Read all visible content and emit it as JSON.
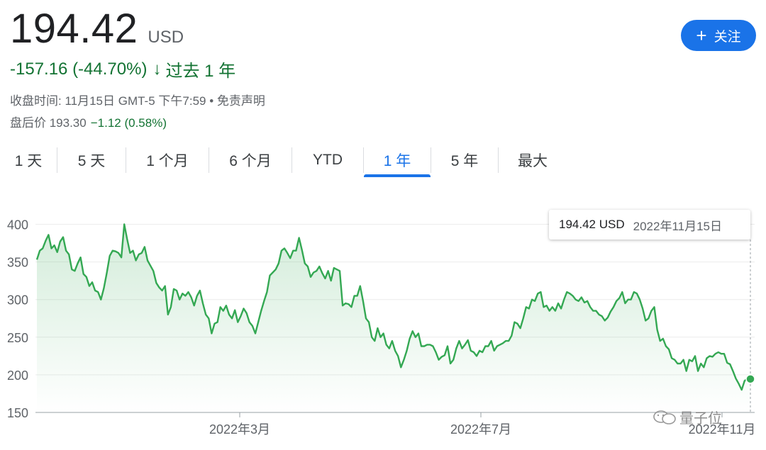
{
  "header": {
    "price": "194.42",
    "currency": "USD",
    "change_text": "-157.16 (-44.70%)",
    "change_arrow": "↓",
    "period_text": "过去 1 年",
    "close_info": "收盘时间: 11月15日 GMT-5 下午7:59 • 免责声明",
    "after_label": "盘后价 193.30",
    "after_change": "−1.12 (0.58%)",
    "follow_label": "关注",
    "follow_icon": "plus-icon"
  },
  "tabs": [
    {
      "label": "1 天",
      "active": false
    },
    {
      "label": "5 天",
      "active": false
    },
    {
      "label": "1 个月",
      "active": false
    },
    {
      "label": "6 个月",
      "active": false
    },
    {
      "label": "YTD",
      "active": false
    },
    {
      "label": "1 年",
      "active": true
    },
    {
      "label": "5 年",
      "active": false
    },
    {
      "label": "最大",
      "active": false
    }
  ],
  "tooltip": {
    "price": "194.42 USD",
    "date": "2022年11月15日"
  },
  "watermark": {
    "text": "量子位",
    "icon": "wechat-icon"
  },
  "colors": {
    "line": "#34a853",
    "accent": "#1a73e8",
    "positive_text": "#137333"
  },
  "chart_data": {
    "type": "area",
    "x_ticks": [
      "2022年3月",
      "2022年7月",
      "2022年11月"
    ],
    "y_ticks": [
      150,
      200,
      250,
      300,
      350,
      400
    ],
    "ylim": [
      150,
      405
    ],
    "grid": true,
    "values": [
      353,
      365,
      368,
      378,
      386,
      368,
      372,
      363,
      377,
      383,
      365,
      360,
      340,
      338,
      348,
      356,
      334,
      330,
      318,
      323,
      312,
      310,
      300,
      315,
      335,
      358,
      365,
      364,
      362,
      356,
      400,
      380,
      362,
      365,
      352,
      360,
      362,
      370,
      352,
      345,
      338,
      322,
      316,
      312,
      318,
      280,
      290,
      314,
      312,
      300,
      308,
      305,
      310,
      303,
      292,
      305,
      312,
      295,
      280,
      275,
      255,
      268,
      270,
      290,
      285,
      292,
      280,
      275,
      286,
      270,
      278,
      288,
      282,
      270,
      265,
      255,
      270,
      285,
      298,
      310,
      332,
      336,
      340,
      348,
      365,
      368,
      362,
      355,
      365,
      365,
      382,
      366,
      348,
      344,
      330,
      336,
      338,
      344,
      335,
      328,
      338,
      325,
      342,
      340,
      338,
      292,
      295,
      294,
      290,
      305,
      305,
      318,
      298,
      275,
      270,
      250,
      245,
      262,
      250,
      255,
      240,
      235,
      245,
      232,
      225,
      210,
      220,
      232,
      248,
      258,
      250,
      255,
      238,
      238,
      240,
      240,
      238,
      230,
      220,
      224,
      226,
      238,
      215,
      220,
      235,
      245,
      235,
      240,
      246,
      232,
      230,
      225,
      232,
      230,
      238,
      238,
      245,
      232,
      238,
      240,
      242,
      245,
      245,
      252,
      270,
      268,
      262,
      275,
      290,
      288,
      300,
      298,
      308,
      310,
      290,
      292,
      285,
      290,
      285,
      295,
      288,
      300,
      310,
      308,
      305,
      300,
      298,
      303,
      296,
      298,
      290,
      285,
      285,
      280,
      278,
      272,
      276,
      284,
      290,
      298,
      302,
      310,
      295,
      300,
      300,
      310,
      308,
      300,
      288,
      272,
      275,
      285,
      290,
      260,
      245,
      248,
      238,
      234,
      222,
      220,
      215,
      215,
      220,
      205,
      220,
      218,
      225,
      205,
      215,
      210,
      222,
      225,
      224,
      228,
      230,
      228,
      228,
      216,
      214,
      205,
      195,
      188,
      180,
      192,
      195,
      194.42
    ]
  }
}
